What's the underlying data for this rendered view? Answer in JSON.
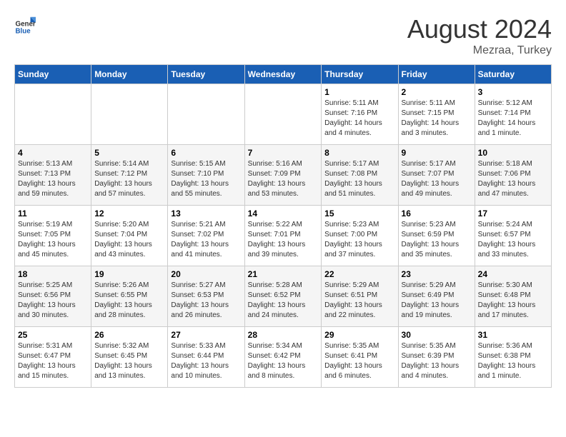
{
  "header": {
    "logo_general": "General",
    "logo_blue": "Blue",
    "title": "August 2024",
    "location": "Mezraa, Turkey"
  },
  "days_of_week": [
    "Sunday",
    "Monday",
    "Tuesday",
    "Wednesday",
    "Thursday",
    "Friday",
    "Saturday"
  ],
  "weeks": [
    [
      {
        "day": "",
        "info": ""
      },
      {
        "day": "",
        "info": ""
      },
      {
        "day": "",
        "info": ""
      },
      {
        "day": "",
        "info": ""
      },
      {
        "day": "1",
        "info": "Sunrise: 5:11 AM\nSunset: 7:16 PM\nDaylight: 14 hours\nand 4 minutes."
      },
      {
        "day": "2",
        "info": "Sunrise: 5:11 AM\nSunset: 7:15 PM\nDaylight: 14 hours\nand 3 minutes."
      },
      {
        "day": "3",
        "info": "Sunrise: 5:12 AM\nSunset: 7:14 PM\nDaylight: 14 hours\nand 1 minute."
      }
    ],
    [
      {
        "day": "4",
        "info": "Sunrise: 5:13 AM\nSunset: 7:13 PM\nDaylight: 13 hours\nand 59 minutes."
      },
      {
        "day": "5",
        "info": "Sunrise: 5:14 AM\nSunset: 7:12 PM\nDaylight: 13 hours\nand 57 minutes."
      },
      {
        "day": "6",
        "info": "Sunrise: 5:15 AM\nSunset: 7:10 PM\nDaylight: 13 hours\nand 55 minutes."
      },
      {
        "day": "7",
        "info": "Sunrise: 5:16 AM\nSunset: 7:09 PM\nDaylight: 13 hours\nand 53 minutes."
      },
      {
        "day": "8",
        "info": "Sunrise: 5:17 AM\nSunset: 7:08 PM\nDaylight: 13 hours\nand 51 minutes."
      },
      {
        "day": "9",
        "info": "Sunrise: 5:17 AM\nSunset: 7:07 PM\nDaylight: 13 hours\nand 49 minutes."
      },
      {
        "day": "10",
        "info": "Sunrise: 5:18 AM\nSunset: 7:06 PM\nDaylight: 13 hours\nand 47 minutes."
      }
    ],
    [
      {
        "day": "11",
        "info": "Sunrise: 5:19 AM\nSunset: 7:05 PM\nDaylight: 13 hours\nand 45 minutes."
      },
      {
        "day": "12",
        "info": "Sunrise: 5:20 AM\nSunset: 7:04 PM\nDaylight: 13 hours\nand 43 minutes."
      },
      {
        "day": "13",
        "info": "Sunrise: 5:21 AM\nSunset: 7:02 PM\nDaylight: 13 hours\nand 41 minutes."
      },
      {
        "day": "14",
        "info": "Sunrise: 5:22 AM\nSunset: 7:01 PM\nDaylight: 13 hours\nand 39 minutes."
      },
      {
        "day": "15",
        "info": "Sunrise: 5:23 AM\nSunset: 7:00 PM\nDaylight: 13 hours\nand 37 minutes."
      },
      {
        "day": "16",
        "info": "Sunrise: 5:23 AM\nSunset: 6:59 PM\nDaylight: 13 hours\nand 35 minutes."
      },
      {
        "day": "17",
        "info": "Sunrise: 5:24 AM\nSunset: 6:57 PM\nDaylight: 13 hours\nand 33 minutes."
      }
    ],
    [
      {
        "day": "18",
        "info": "Sunrise: 5:25 AM\nSunset: 6:56 PM\nDaylight: 13 hours\nand 30 minutes."
      },
      {
        "day": "19",
        "info": "Sunrise: 5:26 AM\nSunset: 6:55 PM\nDaylight: 13 hours\nand 28 minutes."
      },
      {
        "day": "20",
        "info": "Sunrise: 5:27 AM\nSunset: 6:53 PM\nDaylight: 13 hours\nand 26 minutes."
      },
      {
        "day": "21",
        "info": "Sunrise: 5:28 AM\nSunset: 6:52 PM\nDaylight: 13 hours\nand 24 minutes."
      },
      {
        "day": "22",
        "info": "Sunrise: 5:29 AM\nSunset: 6:51 PM\nDaylight: 13 hours\nand 22 minutes."
      },
      {
        "day": "23",
        "info": "Sunrise: 5:29 AM\nSunset: 6:49 PM\nDaylight: 13 hours\nand 19 minutes."
      },
      {
        "day": "24",
        "info": "Sunrise: 5:30 AM\nSunset: 6:48 PM\nDaylight: 13 hours\nand 17 minutes."
      }
    ],
    [
      {
        "day": "25",
        "info": "Sunrise: 5:31 AM\nSunset: 6:47 PM\nDaylight: 13 hours\nand 15 minutes."
      },
      {
        "day": "26",
        "info": "Sunrise: 5:32 AM\nSunset: 6:45 PM\nDaylight: 13 hours\nand 13 minutes."
      },
      {
        "day": "27",
        "info": "Sunrise: 5:33 AM\nSunset: 6:44 PM\nDaylight: 13 hours\nand 10 minutes."
      },
      {
        "day": "28",
        "info": "Sunrise: 5:34 AM\nSunset: 6:42 PM\nDaylight: 13 hours\nand 8 minutes."
      },
      {
        "day": "29",
        "info": "Sunrise: 5:35 AM\nSunset: 6:41 PM\nDaylight: 13 hours\nand 6 minutes."
      },
      {
        "day": "30",
        "info": "Sunrise: 5:35 AM\nSunset: 6:39 PM\nDaylight: 13 hours\nand 4 minutes."
      },
      {
        "day": "31",
        "info": "Sunrise: 5:36 AM\nSunset: 6:38 PM\nDaylight: 13 hours\nand 1 minute."
      }
    ]
  ]
}
